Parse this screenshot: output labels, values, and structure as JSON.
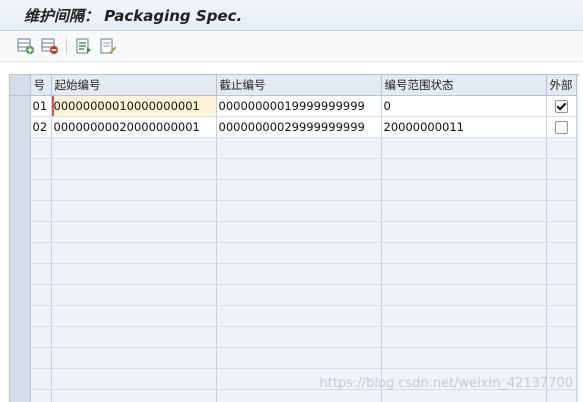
{
  "window": {
    "title": "维护间隔： Packaging Spec."
  },
  "toolbar": {
    "icons": [
      "add-row-icon",
      "delete-row-icon",
      "details-icon",
      "change-icon"
    ]
  },
  "table": {
    "headers": {
      "no": "号",
      "from": "起始编号",
      "to": "截止编号",
      "status": "编号范围状态",
      "ext": "外部"
    },
    "rows": [
      {
        "no": "01",
        "from": "00000000010000000001",
        "to": "00000000019999999999",
        "status": "0",
        "ext": true
      },
      {
        "no": "02",
        "from": "00000000020000000001",
        "to": "00000000029999999999",
        "status": "20000000011",
        "ext": false
      }
    ]
  },
  "watermark": "https://blog.csdn.net/weixin_42137700"
}
